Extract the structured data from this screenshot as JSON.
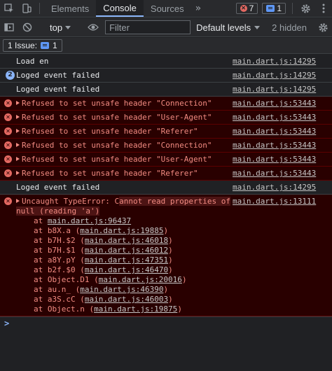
{
  "tabbar": {
    "tabs": [
      "Elements",
      "Console",
      "Sources"
    ],
    "active_tab": "Console",
    "more": "»",
    "error_count": "7",
    "message_count": "1"
  },
  "toolbar": {
    "context": "top",
    "filter_placeholder": "Filter",
    "levels": "Default levels",
    "hidden": "2 hidden"
  },
  "issues": {
    "label": "1 Issue:",
    "count": "1"
  },
  "rows": [
    {
      "type": "info",
      "text": "Load en",
      "source": "main.dart.js:14295"
    },
    {
      "type": "info",
      "text": "Loged event failed",
      "source": "main.dart.js:14295",
      "repeat": "2"
    },
    {
      "type": "info",
      "text": "Loged event failed",
      "source": "main.dart.js:14295"
    },
    {
      "type": "error",
      "text": "Refused to set unsafe header \"Connection\"",
      "source": "main.dart.js:53443"
    },
    {
      "type": "error",
      "text": "Refused to set unsafe header \"User-Agent\"",
      "source": "main.dart.js:53443"
    },
    {
      "type": "error",
      "text": "Refused to set unsafe header \"Referer\"",
      "source": "main.dart.js:53443"
    },
    {
      "type": "error",
      "text": "Refused to set unsafe header \"Connection\"",
      "source": "main.dart.js:53443"
    },
    {
      "type": "error",
      "text": "Refused to set unsafe header \"User-Agent\"",
      "source": "main.dart.js:53443"
    },
    {
      "type": "error",
      "text": "Refused to set unsafe header \"Referer\"",
      "source": "main.dart.js:53443"
    },
    {
      "type": "info",
      "text": "Loged event failed",
      "source": "main.dart.js:14295"
    }
  ],
  "uncaught": {
    "line1_pre": "Uncaught TypeError: C",
    "line1_hl": "annot read properties of",
    "line2": "null (reading 'a')",
    "source": "main.dart.js:13111",
    "stack": [
      {
        "prefix": "at ",
        "link": "main.dart.js:96437"
      },
      {
        "prefix": "at b8X.a (",
        "link": "main.dart.js:19885",
        "suffix": ")"
      },
      {
        "prefix": "at b7H.$2 (",
        "link": "main.dart.js:46018",
        "suffix": ")"
      },
      {
        "prefix": "at b7H.$1 (",
        "link": "main.dart.js:46012",
        "suffix": ")"
      },
      {
        "prefix": "at a8Y.pY (",
        "link": "main.dart.js:47351",
        "suffix": ")"
      },
      {
        "prefix": "at b2f.$0 (",
        "link": "main.dart.js:46470",
        "suffix": ")"
      },
      {
        "prefix": "at Object.D1 (",
        "link": "main.dart.js:20016",
        "suffix": ")"
      },
      {
        "prefix": "at au.n_ (",
        "link": "main.dart.js:46390",
        "suffix": ")"
      },
      {
        "prefix": "at a3S.cC (",
        "link": "main.dart.js:46003",
        "suffix": ")"
      },
      {
        "prefix": "at Object.n (",
        "link": "main.dart.js:19875",
        "suffix": ")"
      }
    ]
  },
  "prompt": ">"
}
